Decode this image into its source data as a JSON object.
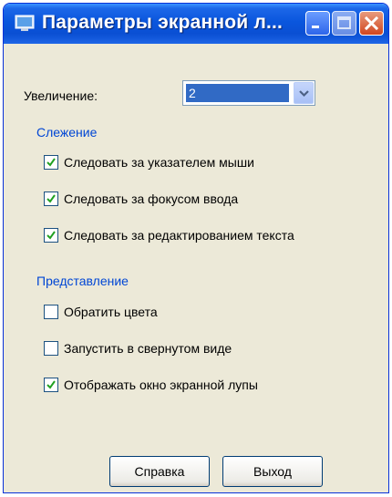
{
  "window": {
    "title": "Параметры экранной л...",
    "colors": {
      "titlebar": "#0a56dd",
      "face": "#ece9d8",
      "accent": "#0046d5",
      "selection": "#316ac5"
    }
  },
  "magnification": {
    "label": "Увеличение:",
    "selected_value": "2"
  },
  "tracking": {
    "label": "Слежение",
    "items": [
      {
        "label": "Следовать за указателем мыши",
        "checked": true
      },
      {
        "label": "Следовать за фокусом ввода",
        "checked": true
      },
      {
        "label": "Следовать за редактированием текста",
        "checked": true
      }
    ]
  },
  "presentation": {
    "label": "Представление",
    "items": [
      {
        "label": "Обратить цвета",
        "checked": false
      },
      {
        "label": "Запустить в свернутом виде",
        "checked": false
      },
      {
        "label": "Отображать окно экранной лупы",
        "checked": true
      }
    ]
  },
  "buttons": {
    "help": "Справка",
    "exit": "Выход"
  }
}
